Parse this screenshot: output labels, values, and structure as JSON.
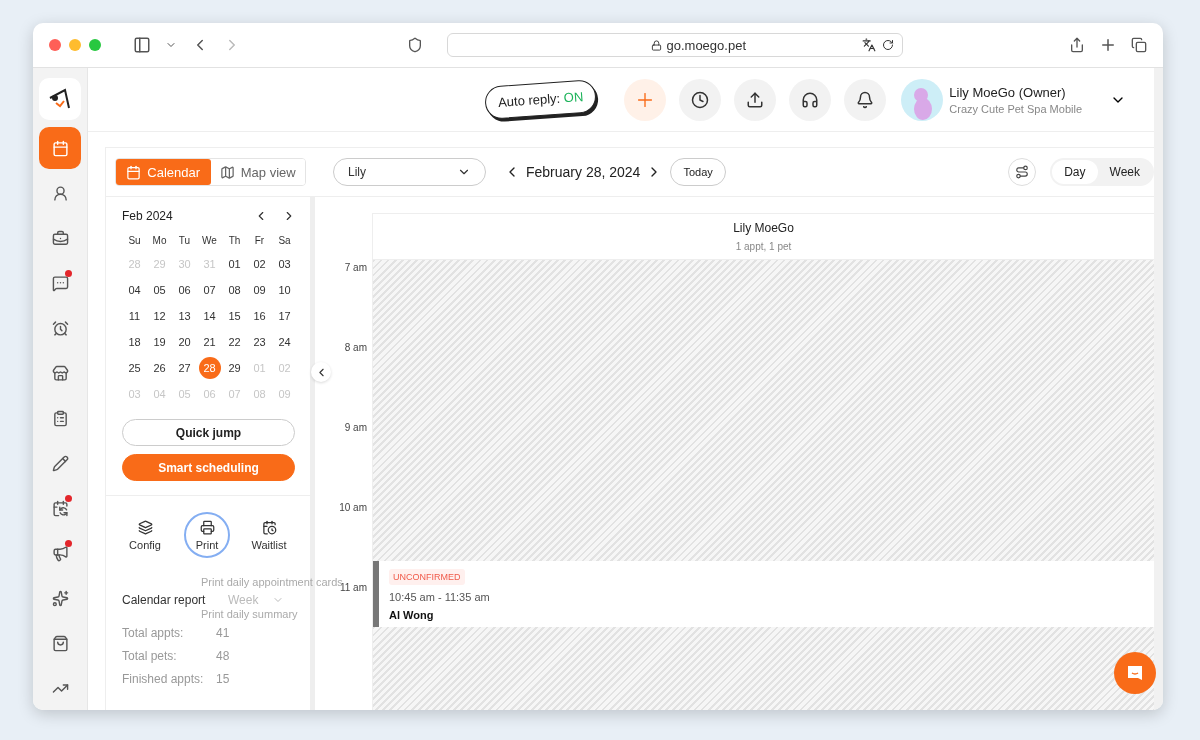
{
  "browser": {
    "url": "go.moego.pet"
  },
  "nav": [
    {
      "kind": "calendar",
      "selected": true,
      "badge": false
    },
    {
      "kind": "clients",
      "selected": false,
      "badge": false
    },
    {
      "kind": "bag",
      "selected": false,
      "badge": false
    },
    {
      "kind": "messages",
      "selected": false,
      "badge": true
    },
    {
      "kind": "reminders",
      "selected": false,
      "badge": false
    },
    {
      "kind": "store",
      "selected": false,
      "badge": false
    },
    {
      "kind": "checklist",
      "selected": false,
      "badge": false
    },
    {
      "kind": "edit",
      "selected": false,
      "badge": false
    },
    {
      "kind": "sync",
      "selected": false,
      "badge": true
    },
    {
      "kind": "marketing",
      "selected": false,
      "badge": true
    },
    {
      "kind": "rewards",
      "selected": false,
      "badge": false
    },
    {
      "kind": "shop",
      "selected": false,
      "badge": false
    },
    {
      "kind": "reports",
      "selected": false,
      "badge": false
    }
  ],
  "header": {
    "auto_reply": {
      "label": "Auto reply:",
      "state": "ON",
      "on": true
    },
    "user": {
      "name": "Lily MoeGo (Owner)",
      "business": "Crazy Cute Pet Spa Mobile"
    }
  },
  "view_tabs": [
    {
      "kind": "calendar",
      "label": "Calendar",
      "selected": true
    },
    {
      "kind": "map",
      "label": "Map view",
      "selected": false
    }
  ],
  "mini_calendar": {
    "month": "Feb 2024",
    "weekdays": [
      "Su",
      "Mo",
      "Tu",
      "We",
      "Th",
      "Fr",
      "Sa"
    ],
    "days": [
      {
        "day": "28",
        "muted": true,
        "selected": false
      },
      {
        "day": "29",
        "muted": true,
        "selected": false
      },
      {
        "day": "30",
        "muted": true,
        "selected": false
      },
      {
        "day": "31",
        "muted": true,
        "selected": false
      },
      {
        "day": "01",
        "muted": false,
        "selected": false
      },
      {
        "day": "02",
        "muted": false,
        "selected": false
      },
      {
        "day": "03",
        "muted": false,
        "selected": false
      },
      {
        "day": "04",
        "muted": false,
        "selected": false
      },
      {
        "day": "05",
        "muted": false,
        "selected": false
      },
      {
        "day": "06",
        "muted": false,
        "selected": false
      },
      {
        "day": "07",
        "muted": false,
        "selected": false
      },
      {
        "day": "08",
        "muted": false,
        "selected": false
      },
      {
        "day": "09",
        "muted": false,
        "selected": false
      },
      {
        "day": "10",
        "muted": false,
        "selected": false
      },
      {
        "day": "11",
        "muted": false,
        "selected": false
      },
      {
        "day": "12",
        "muted": false,
        "selected": false
      },
      {
        "day": "13",
        "muted": false,
        "selected": false
      },
      {
        "day": "14",
        "muted": false,
        "selected": false
      },
      {
        "day": "15",
        "muted": false,
        "selected": false
      },
      {
        "day": "16",
        "muted": false,
        "selected": false
      },
      {
        "day": "17",
        "muted": false,
        "selected": false
      },
      {
        "day": "18",
        "muted": false,
        "selected": false
      },
      {
        "day": "19",
        "muted": false,
        "selected": false
      },
      {
        "day": "20",
        "muted": false,
        "selected": false
      },
      {
        "day": "21",
        "muted": false,
        "selected": false
      },
      {
        "day": "22",
        "muted": false,
        "selected": false
      },
      {
        "day": "23",
        "muted": false,
        "selected": false
      },
      {
        "day": "24",
        "muted": false,
        "selected": false
      },
      {
        "day": "25",
        "muted": false,
        "selected": false
      },
      {
        "day": "26",
        "muted": false,
        "selected": false
      },
      {
        "day": "27",
        "muted": false,
        "selected": false
      },
      {
        "day": "28",
        "muted": false,
        "selected": true
      },
      {
        "day": "29",
        "muted": false,
        "selected": false
      },
      {
        "day": "01",
        "muted": true,
        "selected": false
      },
      {
        "day": "02",
        "muted": true,
        "selected": false
      },
      {
        "day": "03",
        "muted": true,
        "selected": false
      },
      {
        "day": "04",
        "muted": true,
        "selected": false
      },
      {
        "day": "05",
        "muted": true,
        "selected": false
      },
      {
        "day": "06",
        "muted": true,
        "selected": false
      },
      {
        "day": "07",
        "muted": true,
        "selected": false
      },
      {
        "day": "08",
        "muted": true,
        "selected": false
      },
      {
        "day": "09",
        "muted": true,
        "selected": false
      }
    ]
  },
  "quick_jump": "Quick jump",
  "smart_scheduling": "Smart scheduling",
  "tools": [
    {
      "kind": "config",
      "label": "Config",
      "focused": false
    },
    {
      "kind": "print",
      "label": "Print",
      "focused": true
    },
    {
      "kind": "waitlist",
      "label": "Waitlist",
      "focused": false
    }
  ],
  "print_menu": [
    "Print daily appointment cards",
    "Print daily summary"
  ],
  "report": {
    "title": "Calendar report",
    "period": "Week",
    "stats": [
      {
        "label": "Total appts:",
        "value": "41"
      },
      {
        "label": "Total pets:",
        "value": "48"
      },
      {
        "label": "Finished appts:",
        "value": "15"
      }
    ]
  },
  "toolbar": {
    "staff": "Lily",
    "date": "February 28, 2024",
    "today": "Today",
    "views": [
      {
        "label": "Day",
        "selected": true
      },
      {
        "label": "Week",
        "selected": false
      }
    ]
  },
  "schedule": {
    "staff_name": "Lily MoeGo",
    "summary": "1 appt, 1 pet",
    "hours": [
      "7 am",
      "8 am",
      "9 am",
      "10 am",
      "11 am"
    ],
    "appointment": {
      "status": "UNCONFIRMED",
      "time": "10:45 am - 11:35 am",
      "client": "Al Wong"
    }
  }
}
